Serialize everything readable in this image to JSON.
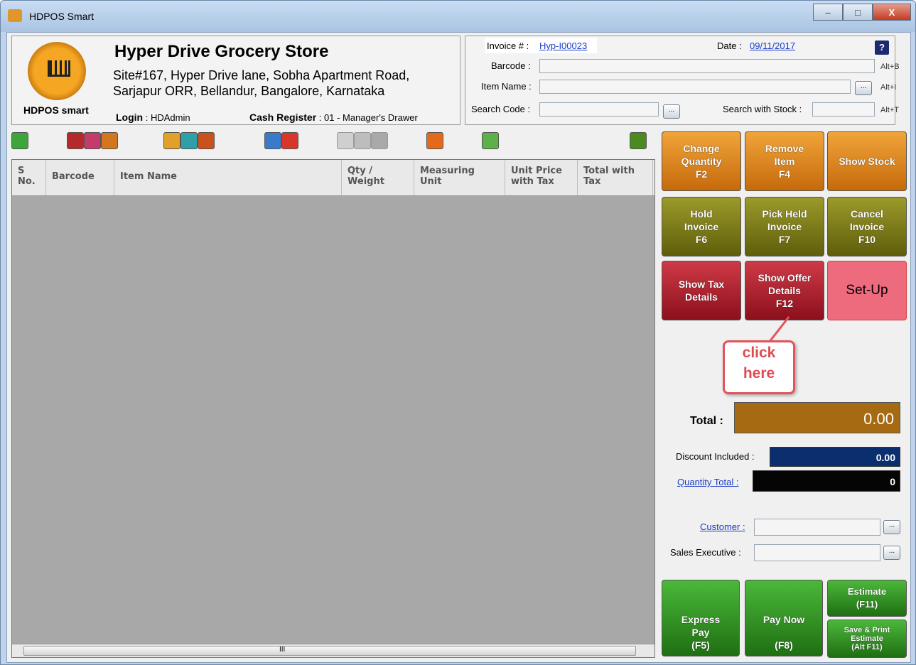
{
  "window": {
    "title": "HDPOS Smart",
    "min": "–",
    "max": "□",
    "close": "X"
  },
  "store": {
    "logo_text": "HDPOS smart",
    "name": "Hyper Drive Grocery Store",
    "address1": "Site#167, Hyper Drive lane, Sobha Apartment Road,",
    "address2": "Sarjapur ORR, Bellandur, Bangalore, Karnataka",
    "login_label": "Login",
    "login_value": ": HDAdmin",
    "register_label": "Cash Register",
    "register_value": ": 01 - Manager's Drawer"
  },
  "invoice": {
    "label": "Invoice # :",
    "number": "Hyp-I00023",
    "date_label": "Date :",
    "date": "09/11/2017",
    "help": "?",
    "barcode_label": "Barcode :",
    "barcode_shortcut": "Alt+B",
    "item_name_label": "Item Name :",
    "item_name_shortcut": "Alt+I",
    "search_code_label": "Search Code :",
    "search_stock_label": "Search with Stock :",
    "search_stock_shortcut": "Alt+T",
    "browse": "..."
  },
  "grid": {
    "columns": [
      {
        "label": "S\nNo."
      },
      {
        "label": "Barcode"
      },
      {
        "label": "Item Name"
      },
      {
        "label": "Qty /\nWeight"
      },
      {
        "label": "Measuring\nUnit"
      },
      {
        "label": "Unit Price\nwith Tax"
      },
      {
        "label": "Total with\nTax"
      }
    ],
    "scroll_marker": "III"
  },
  "actions": {
    "change_quantity": "Change\nQuantity\nF2",
    "remove_item": "Remove\nItem\nF4",
    "show_stock": "Show Stock",
    "hold_invoice": "Hold\nInvoice\nF6",
    "pick_held": "Pick Held\nInvoice\nF7",
    "cancel_invoice": "Cancel\nInvoice\nF10",
    "show_tax": "Show Tax\nDetails",
    "show_offer": "Show Offer\nDetails\nF12",
    "setup": "Set-Up",
    "express_pay": "Express\nPay\n(F5)",
    "pay_now": "Pay Now\n\n(F8)",
    "estimate": "Estimate\n(F11)",
    "save_print_estimate": "Save & Print\nEstimate\n(Alt F11)"
  },
  "callout": {
    "text": "click\nhere"
  },
  "totals": {
    "total_label": "Total :",
    "total_value": "0.00",
    "discount_label": "Discount Included :",
    "discount_value": "0.00",
    "quantity_label": "Quantity Total :",
    "quantity_value": "0",
    "customer_label": "Customer :",
    "sales_exec_label": "Sales Executive :"
  },
  "colors": {
    "setup_button": "#ee6b7e",
    "total_box": "#a66a12",
    "discount_box": "#0b2e6e"
  }
}
